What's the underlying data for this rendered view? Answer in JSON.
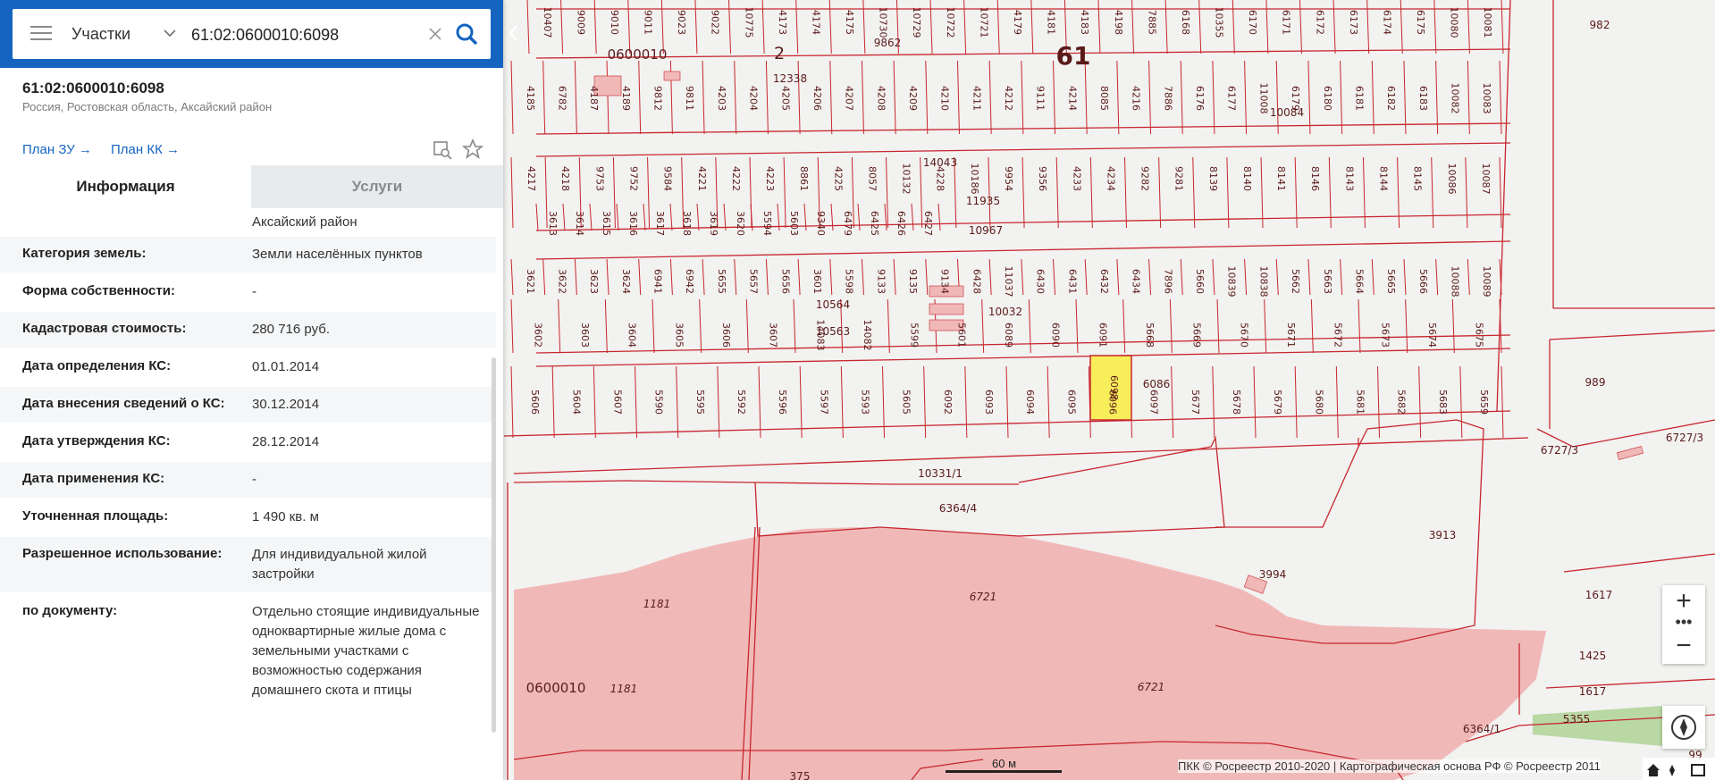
{
  "search": {
    "type_label": "Участки",
    "query": "61:02:0600010:6098"
  },
  "object": {
    "cadastral_number": "61:02:0600010:6098",
    "address_short": "Россия, Ростовская область, Аксайский район",
    "plan_zu": "План ЗУ",
    "plan_kk": "План КК"
  },
  "tabs": {
    "info": "Информация",
    "services": "Услуги"
  },
  "info_rows": {
    "addr_tail": {
      "label": "",
      "value": "Аксайский район"
    },
    "land_category": {
      "label": "Категория земель:",
      "value": "Земли населённых пунктов"
    },
    "ownership": {
      "label": "Форма собственности:",
      "value": "-"
    },
    "cad_cost": {
      "label": "Кадастровая стоимость:",
      "value": "280 716 руб."
    },
    "ks_date": {
      "label": "Дата определения КС:",
      "value": "01.01.2014"
    },
    "ks_entry": {
      "label": "Дата внесения сведений о КС:",
      "value": "30.12.2014"
    },
    "ks_approved": {
      "label": "Дата утверждения КС:",
      "value": "28.12.2014"
    },
    "ks_applied": {
      "label": "Дата применения КС:",
      "value": "-"
    },
    "area": {
      "label": "Уточненная площадь:",
      "value": "1 490 кв. м"
    },
    "permitted_use": {
      "label": "Разрешенное использование:",
      "value": "Для индивидуальной жилой застройки"
    },
    "by_document": {
      "label": "по документу:",
      "value": "Отдельно стоящие индивидуальные одноквартирные жилые дома с земельными участками с возможностью содержания домашнего скота и птицы"
    }
  },
  "map": {
    "colors": {
      "parcel_line": "#c8262e",
      "selected_fill": "#f7ee5a",
      "area_fill": "#f0b9b8",
      "green": "#b9d8a4",
      "background": "#f2f2f0"
    },
    "block_labels": {
      "b1": "0600010",
      "b2": "2",
      "b3": "61",
      "b4": "0600010"
    },
    "labels": {
      "p982": "982",
      "p989": "989",
      "p6727_3a": "6727/3",
      "p6727_3b": "6727/3",
      "p10331": "10331/1",
      "p6364_4": "6364/4",
      "p3913": "3913",
      "p3994": "3994",
      "p1617a": "1617",
      "p1617b": "1617",
      "p1425": "1425",
      "p5355": "5355",
      "p6364_1": "6364/1",
      "p6721a": "6721",
      "p6721b": "6721",
      "p1181a": "1181",
      "p1181b": "1181",
      "p6098": "6098",
      "p6086": "6086",
      "p10032": "10032",
      "p10967": "10967",
      "p11935": "11935",
      "p10084": "10084",
      "p14043": "14043",
      "p9862": "9862",
      "p12338": "12338",
      "p375": "375",
      "p99": "99",
      "p10563": "10563",
      "p10564": "10564"
    },
    "row1": [
      "4185",
      "6782",
      "4187",
      "4189",
      "9812",
      "9811",
      "4203",
      "4204",
      "4205",
      "4206",
      "4207",
      "4208",
      "4209",
      "4210",
      "4211",
      "4212",
      "9111",
      "4214",
      "8085",
      "4216",
      "7886",
      "6176",
      "6177",
      "11008",
      "6179",
      "6180",
      "6181",
      "6182",
      "6183",
      "10082",
      "10083"
    ],
    "row2": [
      "4217",
      "4218",
      "9753",
      "9752",
      "9584",
      "4221",
      "4222",
      "4223",
      "8861",
      "4225",
      "8057",
      "10132",
      "4228",
      "10186",
      "9954",
      "9356",
      "4233",
      "4234",
      "9282",
      "9281",
      "8139",
      "8140",
      "8141",
      "8146",
      "8143",
      "8144",
      "8145",
      "10086",
      "10087"
    ],
    "row3": [
      "3613",
      "3614",
      "3615",
      "3616",
      "3617",
      "3618",
      "3619",
      "3620",
      "5594",
      "5603",
      "9340",
      "6479",
      "6425",
      "6426",
      "6427"
    ],
    "row4": [
      "3621",
      "3622",
      "3623",
      "3624",
      "6941",
      "6942",
      "5655",
      "5657",
      "5656",
      "3601",
      "5598",
      "9133",
      "9135",
      "9134",
      "6428",
      "11037",
      "6430",
      "6431",
      "6432",
      "6434",
      "7896",
      "5660",
      "10839",
      "10838",
      "5662",
      "5663",
      "5664",
      "5665",
      "5666",
      "10088",
      "10089"
    ],
    "row5": [
      "3602",
      "3603",
      "3604",
      "3605",
      "3606",
      "3607",
      "14083",
      "14082",
      "5599",
      "5601",
      "6089",
      "6090",
      "6091",
      "5668",
      "5669",
      "5670",
      "5671",
      "5672",
      "5673",
      "5674",
      "5675"
    ],
    "row6": [
      "5606",
      "5604",
      "5607",
      "5590",
      "5595",
      "5592",
      "5596",
      "5597",
      "5593",
      "5605",
      "6092",
      "6093",
      "6094",
      "6095",
      "6096",
      "6097",
      "5677",
      "5678",
      "5679",
      "5680",
      "5681",
      "5682",
      "5683",
      "5659"
    ],
    "row0": [
      "10407",
      "9009",
      "9010",
      "9011",
      "9023",
      "9022",
      "10775",
      "4173",
      "4174",
      "4175",
      "10730",
      "10729",
      "10722",
      "10721",
      "4179",
      "4181",
      "4183",
      "4198",
      "7885",
      "6168",
      "10355",
      "6170",
      "6171",
      "6172",
      "6173",
      "6174",
      "6175",
      "10080",
      "10081"
    ],
    "scale": "60 м",
    "attribution": "ПКК © Росреестр 2010-2020 | Картографическая основа РФ © Росреестр 2011"
  }
}
